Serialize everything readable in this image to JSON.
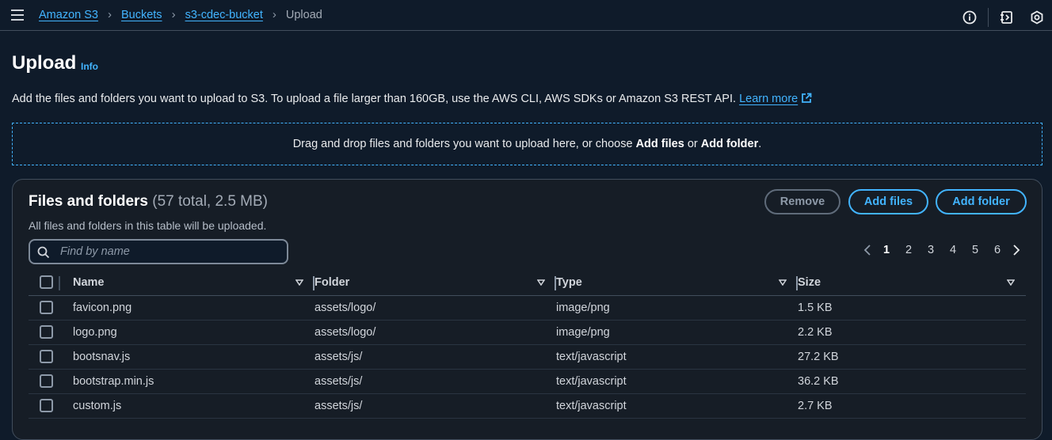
{
  "breadcrumb": {
    "items": [
      "Amazon S3",
      "Buckets",
      "s3-cdec-bucket"
    ],
    "current": "Upload"
  },
  "page": {
    "title": "Upload",
    "info_label": "Info",
    "description": "Add the files and folders you want to upload to S3. To upload a file larger than 160GB, use the AWS CLI, AWS SDKs or Amazon S3 REST API.",
    "learn_more": "Learn more"
  },
  "dropzone": {
    "text_before": "Drag and drop files and folders you want to upload here, or choose ",
    "add_files": "Add files",
    "or": " or ",
    "add_folder": "Add folder",
    "end": "."
  },
  "panel": {
    "title": "Files and folders",
    "count": "(57 total, 2.5 MB)",
    "description": "All files and folders in this table will be uploaded.",
    "remove_label": "Remove",
    "add_files_label": "Add files",
    "add_folder_label": "Add folder",
    "search_placeholder": "Find by name"
  },
  "pagination": {
    "pages": [
      "1",
      "2",
      "3",
      "4",
      "5",
      "6"
    ],
    "current": "1"
  },
  "table": {
    "columns": [
      "Name",
      "Folder",
      "Type",
      "Size"
    ],
    "rows": [
      {
        "name": "favicon.png",
        "folder": "assets/logo/",
        "type": "image/png",
        "size": "1.5 KB"
      },
      {
        "name": "logo.png",
        "folder": "assets/logo/",
        "type": "image/png",
        "size": "2.2 KB"
      },
      {
        "name": "bootsnav.js",
        "folder": "assets/js/",
        "type": "text/javascript",
        "size": "27.2 KB"
      },
      {
        "name": "bootstrap.min.js",
        "folder": "assets/js/",
        "type": "text/javascript",
        "size": "36.2 KB"
      },
      {
        "name": "custom.js",
        "folder": "assets/js/",
        "type": "text/javascript",
        "size": "2.7 KB"
      }
    ]
  },
  "colors": {
    "background": "#0f1b2a",
    "panel": "#161d26",
    "accent": "#42b4ff",
    "border": "#414d5c"
  },
  "icons": [
    "menu-icon",
    "info-circle-icon",
    "notifications-icon",
    "settings-icon",
    "external-link-icon",
    "search-icon",
    "chevron-left-icon",
    "chevron-right-icon",
    "sort-caret-icon"
  ]
}
